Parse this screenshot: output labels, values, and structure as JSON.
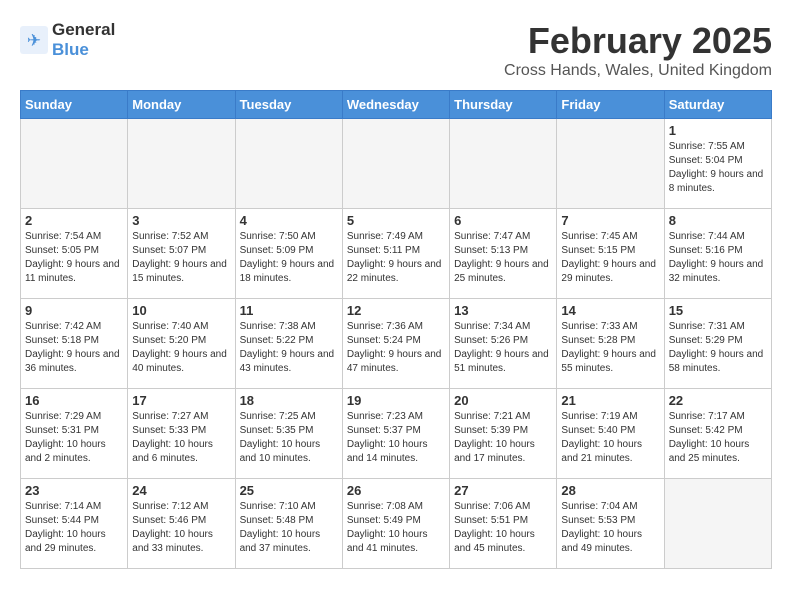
{
  "header": {
    "logo_general": "General",
    "logo_blue": "Blue",
    "title": "February 2025",
    "subtitle": "Cross Hands, Wales, United Kingdom"
  },
  "weekdays": [
    "Sunday",
    "Monday",
    "Tuesday",
    "Wednesday",
    "Thursday",
    "Friday",
    "Saturday"
  ],
  "weeks": [
    [
      {
        "day": "",
        "info": ""
      },
      {
        "day": "",
        "info": ""
      },
      {
        "day": "",
        "info": ""
      },
      {
        "day": "",
        "info": ""
      },
      {
        "day": "",
        "info": ""
      },
      {
        "day": "",
        "info": ""
      },
      {
        "day": "1",
        "info": "Sunrise: 7:55 AM\nSunset: 5:04 PM\nDaylight: 9 hours and 8 minutes."
      }
    ],
    [
      {
        "day": "2",
        "info": "Sunrise: 7:54 AM\nSunset: 5:05 PM\nDaylight: 9 hours and 11 minutes."
      },
      {
        "day": "3",
        "info": "Sunrise: 7:52 AM\nSunset: 5:07 PM\nDaylight: 9 hours and 15 minutes."
      },
      {
        "day": "4",
        "info": "Sunrise: 7:50 AM\nSunset: 5:09 PM\nDaylight: 9 hours and 18 minutes."
      },
      {
        "day": "5",
        "info": "Sunrise: 7:49 AM\nSunset: 5:11 PM\nDaylight: 9 hours and 22 minutes."
      },
      {
        "day": "6",
        "info": "Sunrise: 7:47 AM\nSunset: 5:13 PM\nDaylight: 9 hours and 25 minutes."
      },
      {
        "day": "7",
        "info": "Sunrise: 7:45 AM\nSunset: 5:15 PM\nDaylight: 9 hours and 29 minutes."
      },
      {
        "day": "8",
        "info": "Sunrise: 7:44 AM\nSunset: 5:16 PM\nDaylight: 9 hours and 32 minutes."
      }
    ],
    [
      {
        "day": "9",
        "info": "Sunrise: 7:42 AM\nSunset: 5:18 PM\nDaylight: 9 hours and 36 minutes."
      },
      {
        "day": "10",
        "info": "Sunrise: 7:40 AM\nSunset: 5:20 PM\nDaylight: 9 hours and 40 minutes."
      },
      {
        "day": "11",
        "info": "Sunrise: 7:38 AM\nSunset: 5:22 PM\nDaylight: 9 hours and 43 minutes."
      },
      {
        "day": "12",
        "info": "Sunrise: 7:36 AM\nSunset: 5:24 PM\nDaylight: 9 hours and 47 minutes."
      },
      {
        "day": "13",
        "info": "Sunrise: 7:34 AM\nSunset: 5:26 PM\nDaylight: 9 hours and 51 minutes."
      },
      {
        "day": "14",
        "info": "Sunrise: 7:33 AM\nSunset: 5:28 PM\nDaylight: 9 hours and 55 minutes."
      },
      {
        "day": "15",
        "info": "Sunrise: 7:31 AM\nSunset: 5:29 PM\nDaylight: 9 hours and 58 minutes."
      }
    ],
    [
      {
        "day": "16",
        "info": "Sunrise: 7:29 AM\nSunset: 5:31 PM\nDaylight: 10 hours and 2 minutes."
      },
      {
        "day": "17",
        "info": "Sunrise: 7:27 AM\nSunset: 5:33 PM\nDaylight: 10 hours and 6 minutes."
      },
      {
        "day": "18",
        "info": "Sunrise: 7:25 AM\nSunset: 5:35 PM\nDaylight: 10 hours and 10 minutes."
      },
      {
        "day": "19",
        "info": "Sunrise: 7:23 AM\nSunset: 5:37 PM\nDaylight: 10 hours and 14 minutes."
      },
      {
        "day": "20",
        "info": "Sunrise: 7:21 AM\nSunset: 5:39 PM\nDaylight: 10 hours and 17 minutes."
      },
      {
        "day": "21",
        "info": "Sunrise: 7:19 AM\nSunset: 5:40 PM\nDaylight: 10 hours and 21 minutes."
      },
      {
        "day": "22",
        "info": "Sunrise: 7:17 AM\nSunset: 5:42 PM\nDaylight: 10 hours and 25 minutes."
      }
    ],
    [
      {
        "day": "23",
        "info": "Sunrise: 7:14 AM\nSunset: 5:44 PM\nDaylight: 10 hours and 29 minutes."
      },
      {
        "day": "24",
        "info": "Sunrise: 7:12 AM\nSunset: 5:46 PM\nDaylight: 10 hours and 33 minutes."
      },
      {
        "day": "25",
        "info": "Sunrise: 7:10 AM\nSunset: 5:48 PM\nDaylight: 10 hours and 37 minutes."
      },
      {
        "day": "26",
        "info": "Sunrise: 7:08 AM\nSunset: 5:49 PM\nDaylight: 10 hours and 41 minutes."
      },
      {
        "day": "27",
        "info": "Sunrise: 7:06 AM\nSunset: 5:51 PM\nDaylight: 10 hours and 45 minutes."
      },
      {
        "day": "28",
        "info": "Sunrise: 7:04 AM\nSunset: 5:53 PM\nDaylight: 10 hours and 49 minutes."
      },
      {
        "day": "",
        "info": ""
      }
    ]
  ]
}
